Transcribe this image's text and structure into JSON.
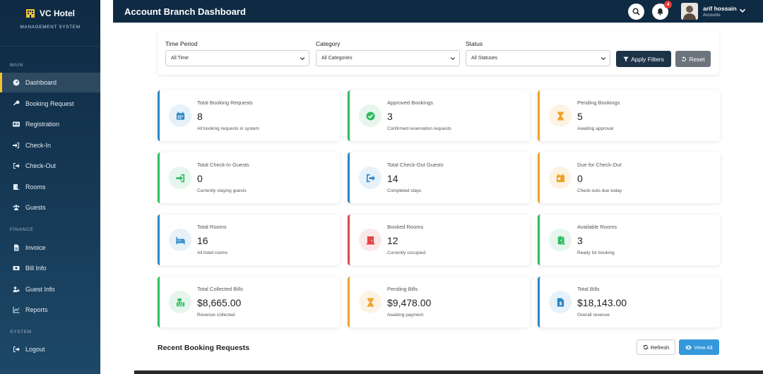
{
  "brand": {
    "name": "VC Hotel",
    "subtitle": "MANAGEMENT SYSTEM"
  },
  "sidebar": {
    "sections": [
      {
        "label": "MAIN"
      },
      {
        "label": "FINANCE"
      },
      {
        "label": "SYSTEM"
      }
    ],
    "items": [
      {
        "label": "Dashboard",
        "icon": "dashboard-icon",
        "active": true
      },
      {
        "label": "Booking Request",
        "icon": "key-icon"
      },
      {
        "label": "Registration",
        "icon": "id-card-icon"
      },
      {
        "label": "Check-In",
        "icon": "sign-in-icon"
      },
      {
        "label": "Check-Out",
        "icon": "sign-out-icon"
      },
      {
        "label": "Rooms",
        "icon": "door-icon"
      },
      {
        "label": "Guests",
        "icon": "users-icon"
      },
      {
        "label": "Invoice",
        "icon": "invoice-icon"
      },
      {
        "label": "Bill Info",
        "icon": "money-bill-icon"
      },
      {
        "label": "Guest Info",
        "icon": "users-cog-icon"
      },
      {
        "label": "Reports",
        "icon": "chart-icon"
      },
      {
        "label": "Logout",
        "icon": "logout-icon"
      }
    ]
  },
  "header": {
    "title": "Account Branch Dashboard",
    "notification_count": "4",
    "user_name": "arif hossain",
    "user_role": "Accounts"
  },
  "filters": {
    "time_label": "Time Period",
    "time_value": "All Time",
    "category_label": "Category",
    "category_value": "All Categories",
    "status_label": "Status",
    "status_value": "All Statuses",
    "apply_label": "Apply Filters",
    "reset_label": "Reset"
  },
  "cards": [
    {
      "title": "Total Booking Requests",
      "value": "8",
      "desc": "All booking requests in system",
      "icon": "calendar-icon",
      "accent": "#2c87c8"
    },
    {
      "title": "Approved Bookings",
      "value": "3",
      "desc": "Confirmed reservation requests",
      "icon": "check-circle-icon",
      "accent": "#2ebd5f"
    },
    {
      "title": "Pending Bookings",
      "value": "5",
      "desc": "Awaiting approval",
      "icon": "hourglass-icon",
      "accent": "#f0a22b"
    },
    {
      "title": "Total Check-In Guests",
      "value": "0",
      "desc": "Currently staying guests",
      "icon": "sign-in-icon",
      "accent": "#2ebd5f"
    },
    {
      "title": "Total Check-Out Guests",
      "value": "14",
      "desc": "Completed stays",
      "icon": "sign-out-icon",
      "accent": "#2c87c8"
    },
    {
      "title": "Due for Check-Out",
      "value": "0",
      "desc": "Check-outs due today",
      "icon": "calendar-day-icon",
      "accent": "#f0a22b"
    },
    {
      "title": "Total Rooms",
      "value": "16",
      "desc": "All hotel rooms",
      "icon": "bed-icon",
      "accent": "#2c87c8"
    },
    {
      "title": "Booked Rooms",
      "value": "12",
      "desc": "Currently occupied",
      "icon": "door-closed-icon",
      "accent": "#e04848"
    },
    {
      "title": "Available Rooms",
      "value": "3",
      "desc": "Ready for booking",
      "icon": "door-open-icon",
      "accent": "#2ebd5f"
    },
    {
      "title": "Total Collected Bills",
      "value": "$8,665.00",
      "desc": "Revenue collected",
      "icon": "cash-register-icon",
      "accent": "#2ebd5f"
    },
    {
      "title": "Pending Bills",
      "value": "$9,478.00",
      "desc": "Awaiting payment",
      "icon": "hourglass-icon",
      "accent": "#f0a22b"
    },
    {
      "title": "Total Bills",
      "value": "$18,143.00",
      "desc": "Overall revenue",
      "icon": "file-invoice-dollar-icon",
      "accent": "#2c87c8"
    }
  ],
  "recent": {
    "title": "Recent Booking Requests",
    "refresh_label": "Refresh",
    "view_all_label": "View All"
  }
}
